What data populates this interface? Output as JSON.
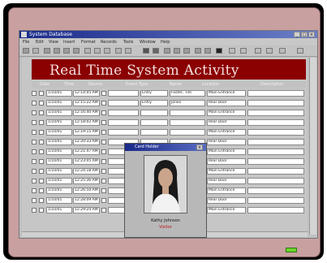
{
  "window": {
    "title": "System Database"
  },
  "menu": [
    "File",
    "Edit",
    "View",
    "Insert",
    "Format",
    "Records",
    "Tools",
    "Window",
    "Help"
  ],
  "banner": {
    "title": "Real Time System Activity"
  },
  "columns": [
    "Date",
    "Time",
    "Device",
    "Event Type",
    "Name",
    "Location",
    "Description"
  ],
  "rows": [
    [
      "1/10/01",
      "12:14:05 AM",
      "",
      "Entry",
      "Foster, Tim",
      "Main Entrance"
    ],
    [
      "1/10/01",
      "12:15:22 AM",
      "",
      "Entry",
      "Jones",
      "Rear Door"
    ],
    [
      "1/10/01",
      "12:16:40 AM",
      "",
      "",
      "",
      "Main Entrance"
    ],
    [
      "1/10/01",
      "12:18:02 AM",
      "",
      "",
      "",
      "Rear Door"
    ],
    [
      "1/10/01",
      "12:19:15 AM",
      "",
      "",
      "",
      "Main Entrance"
    ],
    [
      "1/10/01",
      "12:20:33 AM",
      "",
      "",
      "",
      "Rear Door"
    ],
    [
      "1/10/01",
      "12:21:47 AM",
      "",
      "",
      "",
      "Main Entrance"
    ],
    [
      "1/10/01",
      "12:23:05 AM",
      "",
      "",
      "",
      "Rear Door"
    ],
    [
      "1/10/01",
      "12:24:18 AM",
      "",
      "",
      "",
      "Main Entrance"
    ],
    [
      "1/10/01",
      "12:25:36 AM",
      "",
      "",
      "",
      "Rear Door"
    ],
    [
      "1/10/01",
      "12:26:50 AM",
      "",
      "",
      "",
      "Main Entrance"
    ],
    [
      "1/10/01",
      "12:28:09 AM",
      "",
      "",
      "",
      "Rear Door"
    ],
    [
      "1/10/01",
      "12:29:24 AM",
      "",
      "",
      "",
      "Main Entrance"
    ]
  ],
  "popup": {
    "title": "Card Holder",
    "name": "Kathy Johnson",
    "role": "Visitor"
  },
  "colors": {
    "banner": "#8b0000",
    "mat": "#c9a0a0",
    "titlebar": "#1a2a8a",
    "led": "#6bd42a"
  }
}
